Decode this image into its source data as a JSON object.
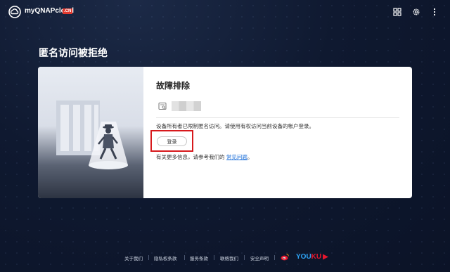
{
  "header": {
    "brand": "myQNAPcloud",
    "badge": ".CN",
    "icons": [
      "apps-grid-icon",
      "settings-gear-icon",
      "more-vertical-icon"
    ]
  },
  "page": {
    "title": "匿名访问被拒绝"
  },
  "card": {
    "title": "故障排除",
    "message": "设备所有者已限制匿名访问。请使用有权访问当前设备的帐户登录。",
    "login_label": "登录",
    "more_prefix": "有关更多信息，请参考我们的 ",
    "faq_link": "常见问题",
    "more_suffix": "。"
  },
  "footer": {
    "links": [
      "关于我们",
      "隐私权条款",
      "服务条款",
      "联络我们",
      "安全声明"
    ],
    "youku": "YOUKU",
    "social_icons": [
      "weibo-icon",
      "youku-logo"
    ]
  },
  "colors": {
    "background": "#0f1930",
    "accent_red": "#d7191c",
    "link_blue": "#1d6fd9",
    "badge_red": "#e03a2f"
  }
}
